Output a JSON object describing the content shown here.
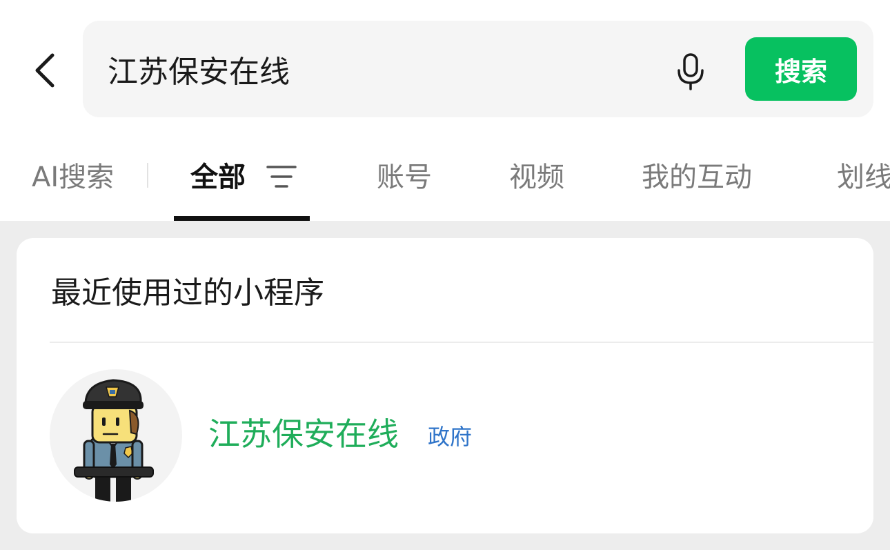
{
  "search": {
    "value": "江苏保安在线",
    "button_label": "搜索"
  },
  "tabs": [
    {
      "label": "AI搜索"
    },
    {
      "label": "全部"
    },
    {
      "label": "账号"
    },
    {
      "label": "视频"
    },
    {
      "label": "我的互动"
    },
    {
      "label": "划线"
    }
  ],
  "recent": {
    "title": "最近使用过的小程序",
    "items": [
      {
        "name": "江苏保安在线",
        "badge": "政府",
        "avatar_icon": "security-guard-icon"
      }
    ]
  },
  "colors": {
    "accent": "#07c160",
    "app_name": "#1fad5a",
    "badge": "#2f74c9"
  }
}
